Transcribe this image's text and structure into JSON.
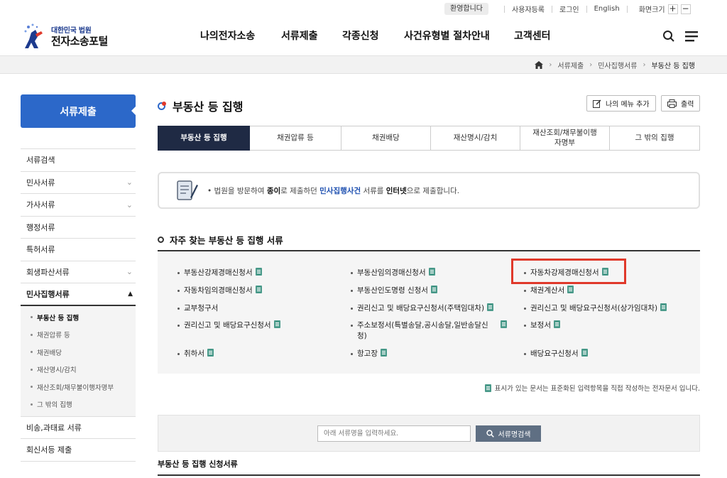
{
  "util": {
    "welcome": "환영합니다",
    "register": "사용자등록",
    "login": "로그인",
    "english": "English",
    "zoom_label": "화면크기",
    "zoom_in": "+",
    "zoom_out": "−"
  },
  "logo": {
    "small": "대한민국 법원",
    "big": "전자소송포털"
  },
  "gnb": [
    "나의전자소송",
    "서류제출",
    "각종신청",
    "사건유형별 절차안내",
    "고객센터"
  ],
  "breadcrumb": [
    "서류제출",
    "민사집행서류",
    "부동산 등 집행"
  ],
  "sidebar": {
    "title": "서류제출",
    "items": [
      {
        "label": "서류검색"
      },
      {
        "label": "민사서류"
      },
      {
        "label": "가사서류"
      },
      {
        "label": "행정서류"
      },
      {
        "label": "특허서류"
      },
      {
        "label": "회생파산서류"
      },
      {
        "label": "민사집행서류"
      }
    ],
    "sub": [
      "부동산 등 집행",
      "채권압류 등",
      "채권배당",
      "재산명시/감치",
      "재산조회/채무불이행자명부",
      "그 밖의 집행"
    ],
    "after": [
      "비송,과태료 서류",
      "회신서등 제출"
    ]
  },
  "page": {
    "title": "부동산 등 집행",
    "my_menu": "나의 메뉴 추가",
    "print": "출력"
  },
  "tabs": [
    "부동산 등 집행",
    "채권압류 등",
    "채권배당",
    "재산명시/감치",
    "재산조회/채무불이행\n자명부",
    "그 밖의 집행"
  ],
  "notice": {
    "p1": "법원을 방문하여 ",
    "b1": "종이",
    "p2": "로 제출하던 ",
    "b2": "민사집행사건",
    "p3": " 서류를 ",
    "b3": "인터넷",
    "p4": "으로 제출합니다."
  },
  "section_title": "자주 찾는 부동산 등 집행 서류",
  "docs": [
    "부동산강제경매신청서",
    "부동산임의경매신청서",
    "자동차강제경매신청서",
    "자동차임의경매신청서",
    "부동산인도명령 신청서",
    "채권계산서",
    "교부청구서",
    "권리신고 및 배당요구신청서(주택임대차)",
    "권리신고 및 배당요구신청서(상가임대차)",
    "권리신고 및 배당요구신청서",
    "주소보정서(특별송달,공시송달,일반송달신청)",
    "보정서",
    "취하서",
    "항고장",
    "배당요구신청서"
  ],
  "legend": "표시가 있는 문서는 표준화된 입력항목을 직접 작성하는 전자문서 입니다.",
  "search": {
    "placeholder": "아래 서류명을 입력하세요.",
    "button": "서류명검색"
  },
  "bottom_title": "부동산 등 집행 신청서류",
  "colors": {
    "accent": "#2c68c9",
    "tab_active": "#1f2a44",
    "highlight": "#e0392b"
  },
  "icons": [
    "home-icon",
    "search-icon",
    "menu-icon",
    "edit-icon",
    "print-icon",
    "document-icon",
    "e-form-icon"
  ]
}
